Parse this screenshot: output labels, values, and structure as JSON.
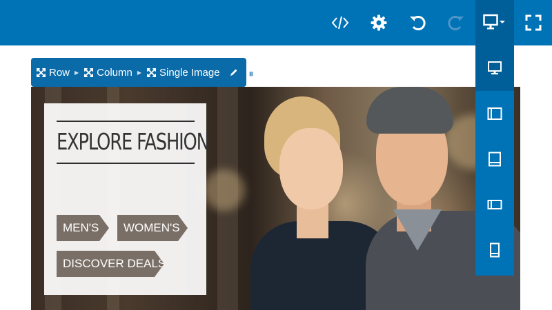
{
  "toolbar": {
    "buttons": [
      {
        "name": "code-view",
        "icon": "code-icon"
      },
      {
        "name": "settings",
        "icon": "gear-icon"
      },
      {
        "name": "undo",
        "icon": "undo-icon"
      },
      {
        "name": "redo",
        "icon": "redo-icon",
        "disabled": true
      },
      {
        "name": "device-preview",
        "icon": "desktop-icon"
      },
      {
        "name": "fullscreen",
        "icon": "fullscreen-icon"
      }
    ],
    "bg_color": "#0073b7",
    "active_color": "#005f99"
  },
  "breadcrumb": {
    "items": [
      {
        "label": "Row",
        "icon": "move-icon"
      },
      {
        "label": "Column",
        "icon": "move-icon"
      },
      {
        "label": "Single Image",
        "icon": "move-icon"
      }
    ],
    "tools": [
      {
        "icon": "pencil-icon"
      },
      {
        "icon": "trash-icon"
      }
    ]
  },
  "hero": {
    "card": {
      "title": "EXPLORE FASHION",
      "tags": [
        "MEN'S",
        "WOMEN'S",
        "DISCOVER DEALS"
      ],
      "tag_color": "#7a6f66"
    }
  },
  "device_menu": {
    "items": [
      {
        "icon": "desktop-icon",
        "active": true
      },
      {
        "icon": "tablet-landscape-icon"
      },
      {
        "icon": "tablet-portrait-icon"
      },
      {
        "icon": "mobile-landscape-icon"
      },
      {
        "icon": "mobile-portrait-icon"
      }
    ]
  }
}
